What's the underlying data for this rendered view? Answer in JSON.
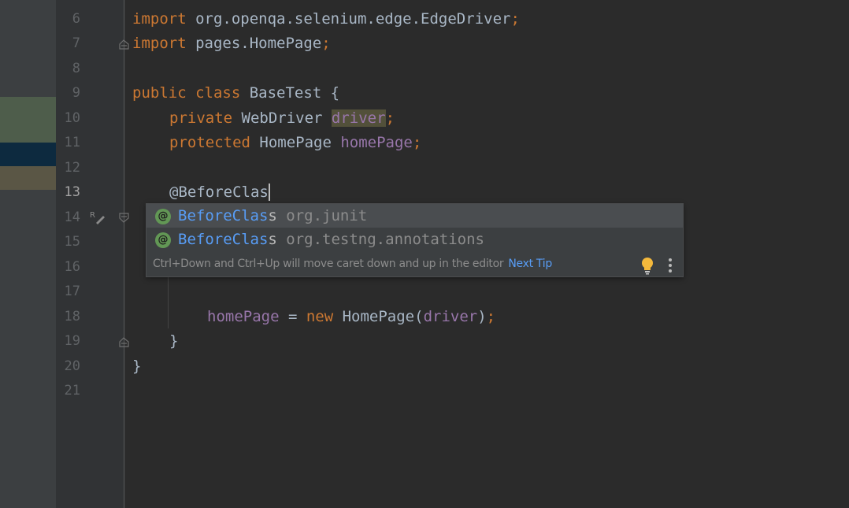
{
  "editor": {
    "line_numbers": [
      "6",
      "7",
      "8",
      "9",
      "10",
      "11",
      "12",
      "13",
      "14",
      "15",
      "16",
      "17",
      "18",
      "19",
      "20",
      "21"
    ],
    "current_line": "13",
    "lines": {
      "l6": {
        "kw": "import",
        "rest": " org.openqa.selenium.edge.EdgeDriver",
        "semi": ";"
      },
      "l7": {
        "kw": "import",
        "rest": " pages.HomePage",
        "semi": ";"
      },
      "l9": {
        "kw": "public class",
        "rest": " BaseTest {"
      },
      "l10": {
        "kw": "private",
        "type": " WebDriver ",
        "field": "driver",
        "semi": ";"
      },
      "l11": {
        "kw": "protected",
        "type": " HomePage ",
        "field": "homePage",
        "semi": ";"
      },
      "l13": {
        "text": "@BeforeClas"
      },
      "l18": {
        "field": "homePage",
        "op": " = ",
        "kw": "new",
        "call": " HomePage(",
        "arg": "driver",
        "close": ")",
        "semi": ";"
      },
      "l19": {
        "text": "}"
      },
      "l20": {
        "text": "}"
      }
    }
  },
  "completion": {
    "items": [
      {
        "match": "BeforeClas",
        "rest": "s",
        "package": "org.junit",
        "badge": "@"
      },
      {
        "match": "BeforeClas",
        "rest": "s",
        "package": "org.testng.annotations",
        "badge": "@"
      }
    ],
    "tip": "Ctrl+Down and Ctrl+Up will move caret down and up in the editor",
    "next_tip": "Next Tip"
  },
  "colors": {
    "background": "#2b2b2b",
    "keyword": "#cc7832",
    "field": "#9876aa",
    "match": "#589df6",
    "badge": "#629755"
  }
}
